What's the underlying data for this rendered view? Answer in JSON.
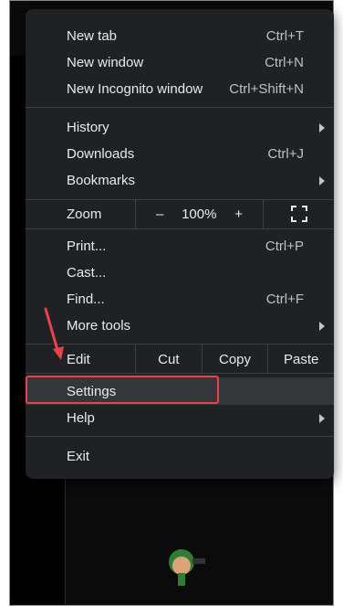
{
  "menu": {
    "group1": [
      {
        "label": "New tab",
        "shortcut": "Ctrl+T"
      },
      {
        "label": "New window",
        "shortcut": "Ctrl+N"
      },
      {
        "label": "New Incognito window",
        "shortcut": "Ctrl+Shift+N"
      }
    ],
    "group2": [
      {
        "label": "History",
        "shortcut": ""
      },
      {
        "label": "Downloads",
        "shortcut": "Ctrl+J"
      },
      {
        "label": "Bookmarks",
        "shortcut": ""
      }
    ],
    "zoom": {
      "label": "Zoom",
      "minus": "–",
      "value": "100%",
      "plus": "+"
    },
    "group3": [
      {
        "label": "Print...",
        "shortcut": "Ctrl+P"
      },
      {
        "label": "Cast...",
        "shortcut": ""
      },
      {
        "label": "Find...",
        "shortcut": "Ctrl+F"
      },
      {
        "label": "More tools",
        "shortcut": ""
      }
    ],
    "edit": {
      "label": "Edit",
      "cut": "Cut",
      "copy": "Copy",
      "paste": "Paste"
    },
    "group4": [
      {
        "label": "Settings"
      },
      {
        "label": "Help"
      }
    ],
    "exit": {
      "label": "Exit"
    }
  },
  "colors": {
    "menu_bg": "#202124",
    "menu_text": "#e8eaed",
    "highlight": "#35363a",
    "annotation": "#e8424c"
  }
}
